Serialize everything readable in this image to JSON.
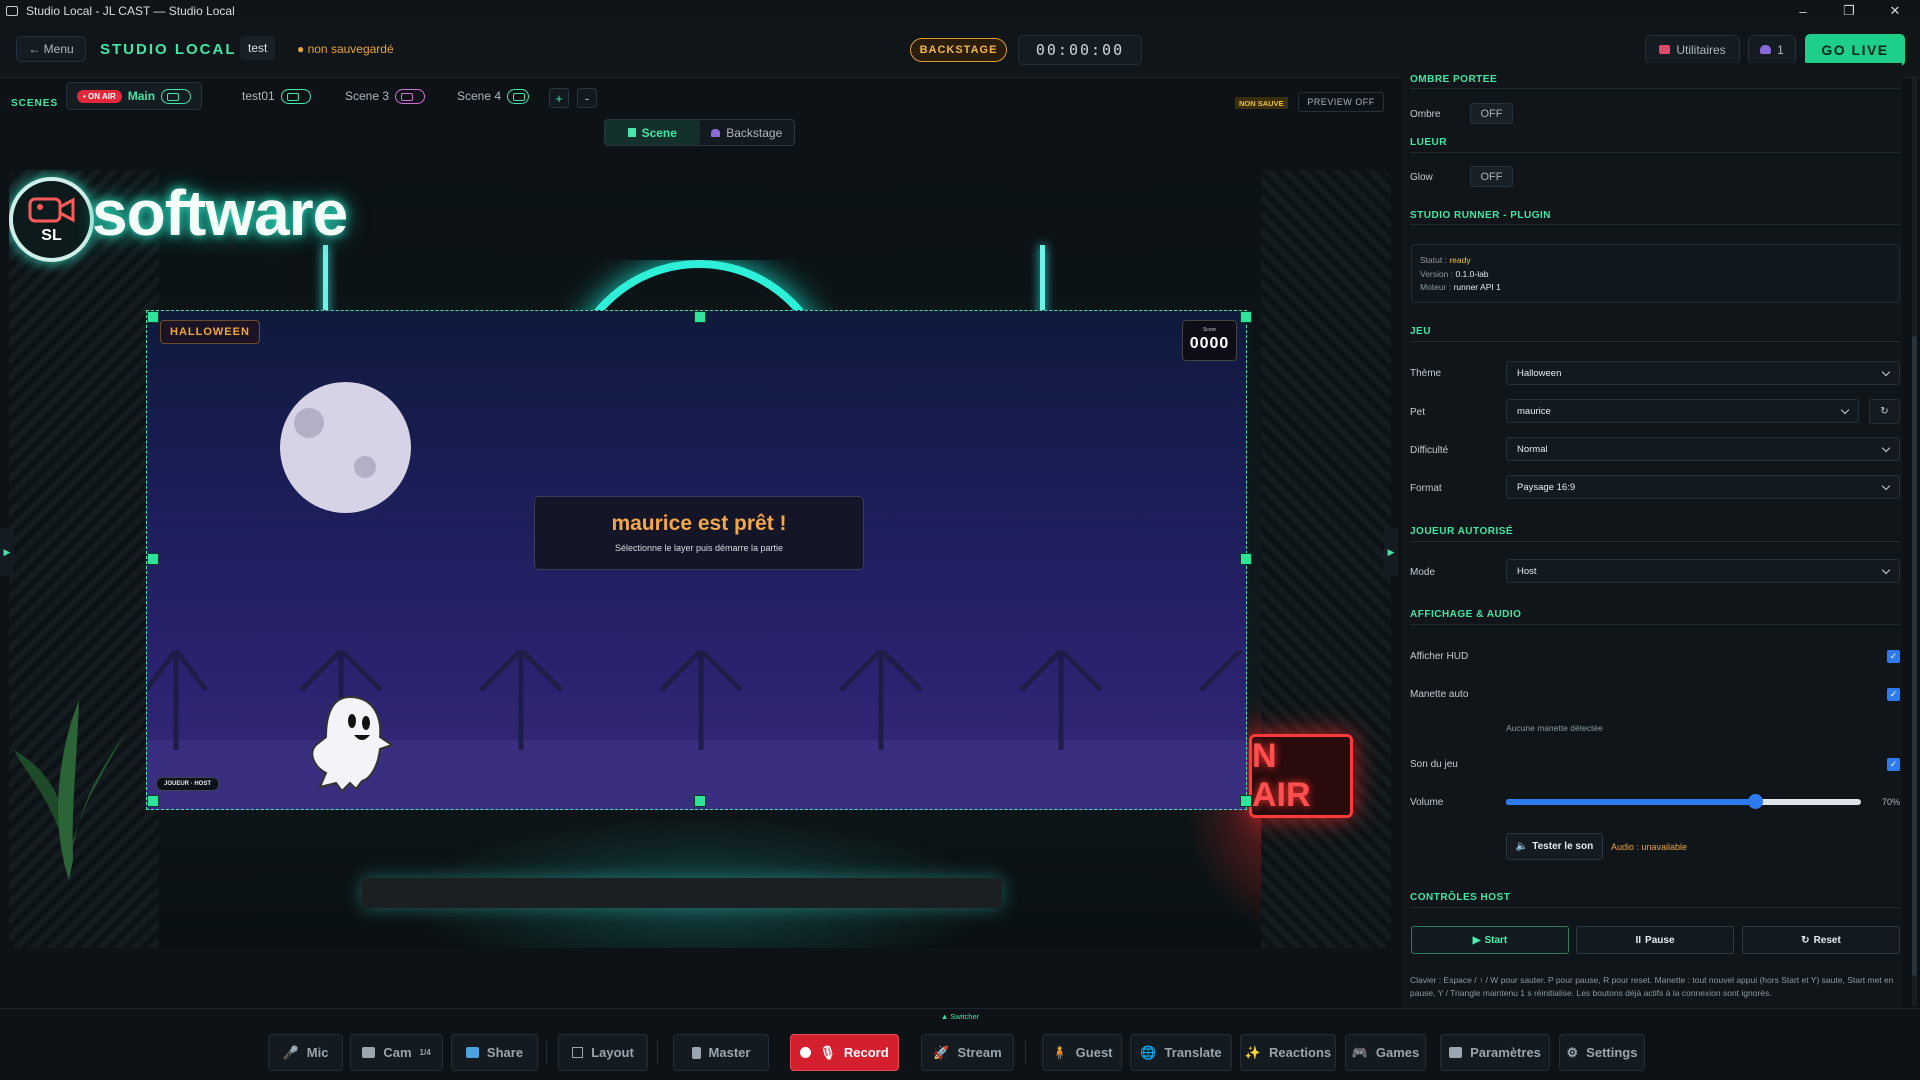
{
  "window": {
    "title": "Studio Local - JL CAST — Studio Local"
  },
  "header": {
    "menu_label": "← Menu",
    "brand": "STUDIO LOCAL",
    "project_name": "test",
    "unsaved_status": "● non sauvegardé",
    "mode_badge": "BACKSTAGE",
    "timer": "00:00:00",
    "utilities_label": "Utilitaires",
    "guests_count": "1",
    "go_live_label": "GO LIVE"
  },
  "scenes": {
    "label": "SCENES",
    "on_air_badge": "• ON AIR",
    "items": [
      {
        "name": "Main"
      },
      {
        "name": "test01"
      },
      {
        "name": "Scene 3"
      },
      {
        "name": "Scene 4"
      }
    ],
    "add_label": "+",
    "remove_label": "-",
    "non_save_badge": "NON SAUVE",
    "preview_label": "PREVIEW OFF",
    "view_tabs": [
      "Scene",
      "Backstage"
    ]
  },
  "stage": {
    "logo_text": "software",
    "logo_initials": "SL",
    "on_air_sign": "N AIR",
    "game": {
      "theme_tag": "HALLOWEEN",
      "score_label": "Score",
      "score_value": "0000",
      "ready_title": "maurice est prêt !",
      "ready_subtitle": "Sélectionne le layer puis démarre la partie",
      "player_tag": "JOUEUR · HOST"
    }
  },
  "panel": {
    "shadow": {
      "title": "OMBRE PORTEE",
      "label": "Ombre",
      "value": "OFF"
    },
    "glow": {
      "title": "LUEUR",
      "label": "Glow",
      "value": "OFF"
    },
    "runner": {
      "title": "STUDIO RUNNER - PLUGIN",
      "status_label": "Statut :",
      "status_value": "ready",
      "version_label": "Version :",
      "version_value": "0.1.0-lab",
      "engine_label": "Moteur :",
      "engine_value": "runner API 1"
    },
    "game": {
      "title": "JEU",
      "theme_label": "Thème",
      "theme_value": "Halloween",
      "pet_label": "Pet",
      "pet_value": "maurice",
      "pet_refresh": "↻",
      "difficulty_label": "Difficulté",
      "difficulty_value": "Normal",
      "format_label": "Format",
      "format_value": "Paysage 16:9"
    },
    "player": {
      "title": "JOUEUR AUTORISÉ",
      "mode_label": "Mode",
      "mode_value": "Host"
    },
    "display": {
      "title": "AFFICHAGE & AUDIO",
      "hud_label": "Afficher HUD",
      "gamepad_label": "Manette auto",
      "gamepad_status": "Aucune manette détectée",
      "sound_label": "Son du jeu",
      "volume_label": "Volume",
      "volume_value": 0.7,
      "volume_text": "70%",
      "test_sound_label": "Tester le son",
      "audio_status": "Audio : unavailable"
    },
    "host": {
      "title": "CONTRÔLES HOST",
      "start_label": "Start",
      "pause_label": "Pause",
      "reset_label": "Reset",
      "help": "Clavier : Espace / ↑ / W pour sauter. P pour pause, R pour reset. Manette : tout nouvel appui (hors Start et Y) saute, Start met en pause, Y / Triangle maintenu 1 s réinitialise. Les boutons déjà actifs à la connexion sont ignorés."
    }
  },
  "switcher_label": "▲ Switcher",
  "bottom": {
    "mic": "Mic",
    "cam": "Cam",
    "cam_count": "1/4",
    "share": "Share",
    "layout": "Layout",
    "master": "Master",
    "record": "Record",
    "stream": "Stream",
    "guest": "Guest",
    "translate": "Translate",
    "reactions": "Reactions",
    "games": "Games",
    "parametres": "Paramètres",
    "settings": "Settings"
  },
  "colors": {
    "accent": "#43e6a6",
    "record": "#d41f2e",
    "warning": "#e8a33d"
  }
}
